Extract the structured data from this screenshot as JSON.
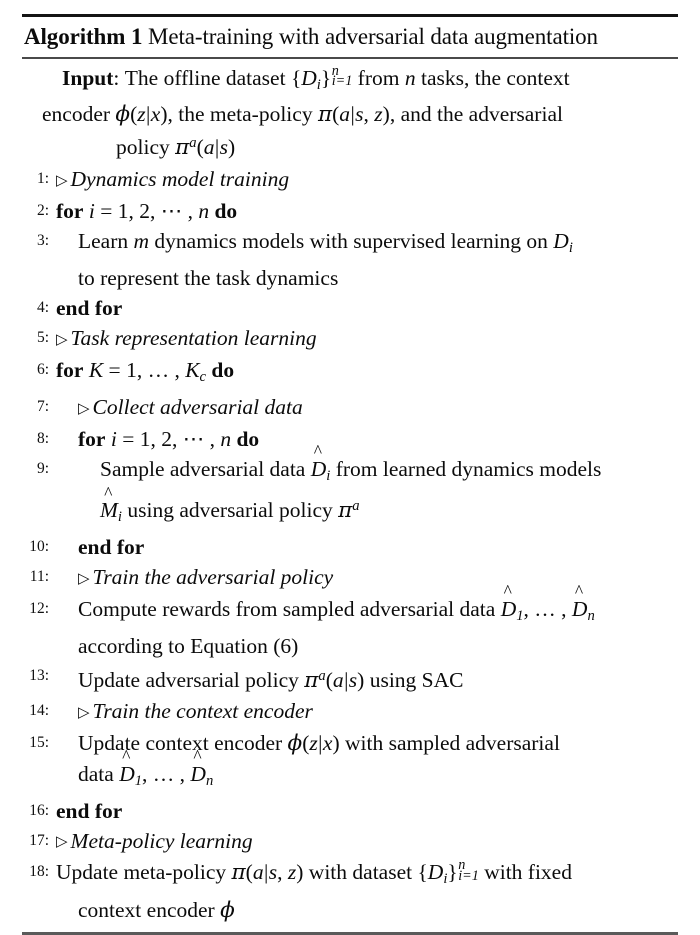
{
  "document": {
    "type": "algorithm-pseudocode",
    "background_color": "#ffffff",
    "text_color": "#0b0b0b",
    "rule_color_top": "#141414",
    "rule_color_bottom": "#5a5a5a"
  },
  "header": {
    "keyword": "Algorithm",
    "number": "1",
    "title": "Meta-training with adversarial data augmentation",
    "full_text": "Algorithm 1 Meta-training with adversarial data augmentation"
  },
  "input": {
    "label": "Input",
    "colon": ":",
    "line1_a": "The offline dataset ",
    "line1_set_open": "{",
    "line1_D": "D",
    "line1_D_sub": "i",
    "line1_set_close": "}",
    "line1_sup": "n",
    "line1_sub": "i=1",
    "line1_b": " from ",
    "line1_n": "n",
    "line1_c": " tasks, the context",
    "line2_a": "encoder ",
    "line2_phi": "ϕ",
    "line2_paren1": "(",
    "line2_z": "z",
    "line2_bar": "|",
    "line2_x": "x",
    "line2_paren2": ")",
    "line2_b": ", the meta-policy ",
    "line2_pi": "π",
    "line2_c": "(",
    "line2_a_arg": "a",
    "line2_bar2": "|",
    "line2_s": "s",
    "line2_comma": ", ",
    "line2_z2": "z",
    "line2_d": ")",
    "line2_e": ", and the adversarial",
    "line3_a": "policy ",
    "line3_pi": "π",
    "line3_sup": "a",
    "line3_b": "(",
    "line3_a_arg": "a",
    "line3_bar": "|",
    "line3_s": "s",
    "line3_c": ")"
  },
  "triangle_marker": "▷",
  "steps": [
    {
      "num": "1:",
      "indent": 0,
      "kind": "comment",
      "text": "Dynamics model training"
    },
    {
      "num": "2:",
      "indent": 0,
      "kind": "for",
      "keyword_for": "for",
      "var": "i",
      "eq": " = ",
      "range": "1, 2, ⋯ , ",
      "bound": "n",
      "keyword_do": "do"
    },
    {
      "num": "3:",
      "indent": 1,
      "kind": "statement",
      "line1_a": "Learn ",
      "line1_m": "m",
      "line1_b": " dynamics models with supervised learning on ",
      "line1_D": "D",
      "line1_D_sub": "i",
      "line2": "to represent the task dynamics"
    },
    {
      "num": "4:",
      "indent": 0,
      "kind": "endfor",
      "text": "end for"
    },
    {
      "num": "5:",
      "indent": 0,
      "kind": "comment",
      "text": "Task representation learning"
    },
    {
      "num": "6:",
      "indent": 0,
      "kind": "for",
      "keyword_for": "for",
      "var": "K",
      "eq": " = ",
      "range": "1, … , ",
      "bound": "K",
      "bound_sub": "c",
      "keyword_do": "do"
    },
    {
      "num": "7:",
      "indent": 1,
      "kind": "comment",
      "text": "Collect adversarial data"
    },
    {
      "num": "8:",
      "indent": 1,
      "kind": "for",
      "keyword_for": "for",
      "var": "i",
      "eq": " = ",
      "range": "1, 2, ⋯ , ",
      "bound": "n",
      "keyword_do": "do"
    },
    {
      "num": "9:",
      "indent": 2,
      "kind": "statement",
      "line1_a": "Sample adversarial data ",
      "line1_D": "D",
      "line1_D_sub": "i",
      "line1_b": " from learned dynamics models",
      "line2_M": "M",
      "line2_M_sub": "i",
      "line2_a": " using adversarial policy ",
      "line2_pi": "π",
      "line2_sup": "a"
    },
    {
      "num": "10:",
      "indent": 1,
      "kind": "endfor",
      "text": "end for"
    },
    {
      "num": "11:",
      "indent": 1,
      "kind": "comment",
      "text": "Train the adversarial policy"
    },
    {
      "num": "12:",
      "indent": 1,
      "kind": "statement",
      "line1_a": "Compute rewards from sampled adversarial data ",
      "line1_D1": "D",
      "line1_D1_sub": "1",
      "line1_mid": ", … , ",
      "line1_Dn": "D",
      "line1_Dn_sub": "n",
      "line2": "according to Equation (6)"
    },
    {
      "num": "13:",
      "indent": 1,
      "kind": "statement",
      "line1_a": "Update adversarial policy ",
      "line1_pi": "π",
      "line1_sup": "a",
      "line1_b": "(",
      "line1_arg": "a",
      "line1_bar": "|",
      "line1_s": "s",
      "line1_c": ")",
      "line1_d": " using SAC"
    },
    {
      "num": "14:",
      "indent": 1,
      "kind": "comment",
      "text": "Train the context encoder"
    },
    {
      "num": "15:",
      "indent": 1,
      "kind": "statement",
      "line1_a": "Update context encoder ",
      "line1_phi": "ϕ",
      "line1_b": "(",
      "line1_z": "z",
      "line1_bar": "|",
      "line1_x": "x",
      "line1_c": ")",
      "line1_d": " with sampled adversarial",
      "line2_a": "data ",
      "line2_D1": "D",
      "line2_D1_sub": "1",
      "line2_mid": ", … , ",
      "line2_Dn": "D",
      "line2_Dn_sub": "n"
    },
    {
      "num": "16:",
      "indent": 0,
      "kind": "endfor",
      "text": "end for"
    },
    {
      "num": "17:",
      "indent": 0,
      "kind": "comment",
      "text": "Meta-policy learning"
    },
    {
      "num": "18:",
      "indent": 0,
      "kind": "statement",
      "line1_a": "Update meta-policy ",
      "line1_pi": "π",
      "line1_b": "(",
      "line1_arg": "a",
      "line1_bar": "|",
      "line1_s": "s",
      "line1_comma": ", ",
      "line1_z": "z",
      "line1_c": ")",
      "line1_d": " with dataset ",
      "line1_set_open": "{",
      "line1_D": "D",
      "line1_D_sub": "i",
      "line1_set_close": "}",
      "line1_sup": "n",
      "line1_sub": "i=1",
      "line1_e": " with fixed",
      "line2_a": "context encoder ",
      "line2_phi": "ϕ"
    }
  ]
}
